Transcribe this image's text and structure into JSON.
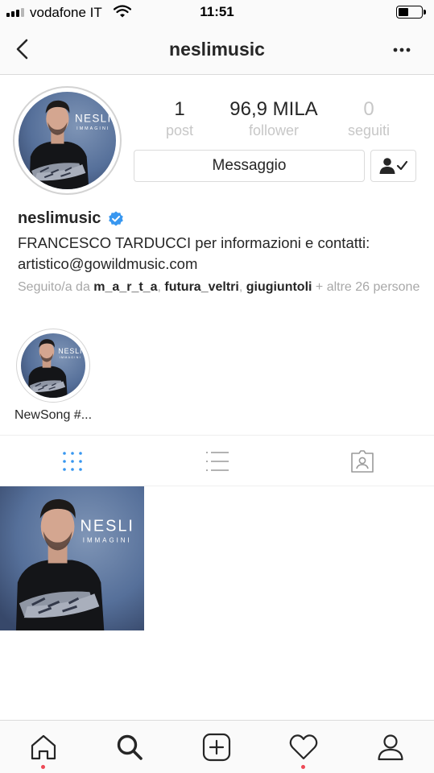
{
  "status_bar": {
    "carrier": "vodafone IT",
    "time": "11:51",
    "battery_level": 0.45
  },
  "nav": {
    "title": "neslimusic"
  },
  "profile": {
    "username": "neslimusic",
    "verified": true,
    "stats": [
      {
        "value": "1",
        "label": "post"
      },
      {
        "value": "96,9 MILA",
        "label": "follower"
      },
      {
        "value": "0",
        "label": "seguiti"
      }
    ],
    "message_label": "Messaggio",
    "bio_line1": "FRANCESCO TARDUCCI per informazioni e contatti:",
    "bio_line2": "artistico@gowildmusic.com",
    "followed_by": {
      "prefix": "Seguito/a da ",
      "users": [
        "m_a_r_t_a",
        "futura_veltri",
        "giugiuntoli"
      ],
      "separator": ", ",
      "suffix": " + altre 26 persone"
    },
    "artwork": {
      "title": "NESLI",
      "subtitle": "IMMAGINI"
    }
  },
  "highlights": [
    {
      "label": "NewSong #..."
    }
  ],
  "tabs": [
    {
      "icon": "grid-icon",
      "active": true
    },
    {
      "icon": "list-icon",
      "active": false
    },
    {
      "icon": "tagged-icon",
      "active": false
    }
  ],
  "bottom_nav": [
    {
      "icon": "home-icon",
      "notification": true
    },
    {
      "icon": "search-icon",
      "notification": false
    },
    {
      "icon": "add-post-icon",
      "notification": false
    },
    {
      "icon": "heart-icon",
      "notification": true
    },
    {
      "icon": "profile-icon",
      "notification": false
    }
  ],
  "colors": {
    "accent": "#3897f0",
    "verified": "#3897f0",
    "notification": "#ed4956",
    "muted_text": "#c7c7c7",
    "artwork_bg": "#4f6a8e"
  }
}
